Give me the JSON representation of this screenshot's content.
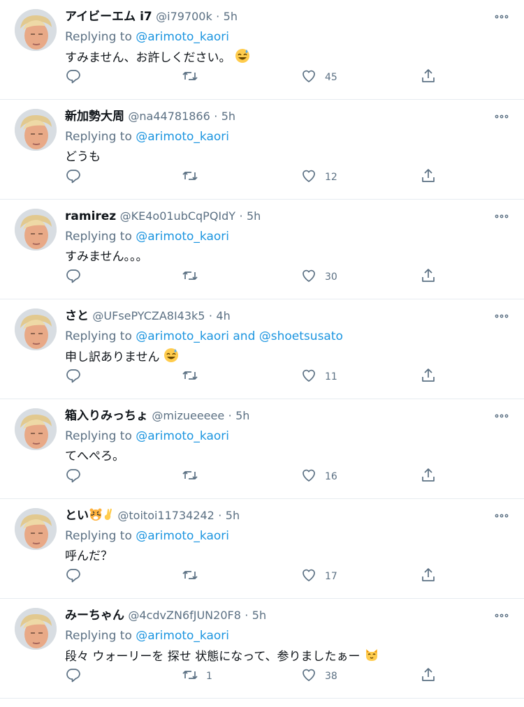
{
  "tweets": [
    {
      "name": "アイビーエム i7",
      "handle": "@i79700k",
      "sep": "·",
      "time": "5h",
      "replying": "Replying to",
      "mentions": "@arimoto_kaori",
      "text": "すみません、お許しください。",
      "emoji": "sweat-smile",
      "replies": "",
      "retweets": "",
      "likes": "45"
    },
    {
      "name": "新加勢大周",
      "handle": "@na44781866",
      "sep": "·",
      "time": "5h",
      "replying": "Replying to",
      "mentions": "@arimoto_kaori",
      "text": "どうも",
      "emoji": "",
      "replies": "",
      "retweets": "",
      "likes": "12"
    },
    {
      "name": "ramirez",
      "handle": "@KE4o01ubCqPQIdY",
      "sep": "·",
      "time": "5h",
      "replying": "Replying to",
      "mentions": "@arimoto_kaori",
      "text": "すみません。。。",
      "emoji": "",
      "replies": "",
      "retweets": "",
      "likes": "30"
    },
    {
      "name": "さと",
      "handle": "@UFsePYCZA8I43k5",
      "sep": "·",
      "time": "4h",
      "replying": "Replying to",
      "mentions": "@arimoto_kaori and @shoetsusato",
      "text": "申し訳ありません",
      "emoji": "sweat-smile",
      "replies": "",
      "retweets": "",
      "likes": "11"
    },
    {
      "name": "箱入りみっちょ",
      "handle": "@mizueeeee",
      "sep": "·",
      "time": "5h",
      "replying": "Replying to",
      "mentions": "@arimoto_kaori",
      "text": "てへぺろ。",
      "emoji": "",
      "replies": "",
      "retweets": "",
      "likes": "16"
    },
    {
      "name": "とい",
      "handle": "@toitoi11734242",
      "sep": "·",
      "time": "5h",
      "replying": "Replying to",
      "mentions": "@arimoto_kaori",
      "text": "呼んだ？",
      "emoji": "",
      "replies": "",
      "retweets": "",
      "likes": "17"
    },
    {
      "name": "みーちゃん",
      "handle": "@4cdvZN6fJUN20F8",
      "sep": "·",
      "time": "5h",
      "replying": "Replying to",
      "mentions": "@arimoto_kaori",
      "text": "段々 ウォーリーを 探せ 状態になって、参りましたぁー",
      "emoji": "cat-face",
      "replies": "",
      "retweets": "1",
      "likes": "38"
    }
  ],
  "colors": {
    "link": "#1b95e0",
    "muted": "#5b7083",
    "divider": "#e6ecf0"
  },
  "icons": {
    "reply": "reply-icon",
    "retweet": "retweet-icon",
    "like": "heart-icon",
    "share": "share-icon",
    "more": "more-icon"
  }
}
